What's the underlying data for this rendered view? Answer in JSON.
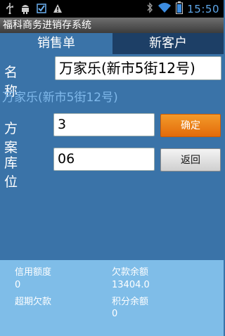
{
  "status_bar": {
    "time": "15:50",
    "left_icons": [
      "usb-icon",
      "android-debug-icon",
      "download-done-icon",
      "warning-icon"
    ],
    "right_icons": [
      "bluetooth-icon",
      "wifi-icon",
      "battery-icon"
    ]
  },
  "app": {
    "title": "福科商务进销存系统"
  },
  "tabs": [
    {
      "label": "销售单",
      "active": true
    },
    {
      "label": "新客户",
      "active": false
    }
  ],
  "form": {
    "name_label": "名 称",
    "name_value": "万家乐(新市5街12号)",
    "customer_display": "万家乐(新市5街12号)",
    "plan_label": "方 案",
    "plan_value": "3",
    "confirm_label": "确定",
    "location_label": "库 位",
    "location_value": "06",
    "back_label": "返回"
  },
  "info": {
    "credit_limit_label": "信用额度",
    "credit_limit_value": "0",
    "debt_balance_label": "欠款余额",
    "debt_balance_value": "13404.0",
    "overdue_label": "超期欠款",
    "points_label": "积分余额",
    "points_value": "0"
  },
  "colors": {
    "background": "#3a73a8",
    "tab_inactive": "#1d3f66",
    "confirm_button": "#e36b0b",
    "info_panel": "#7fbde8",
    "customer_display_text": "#7fb8ea"
  }
}
